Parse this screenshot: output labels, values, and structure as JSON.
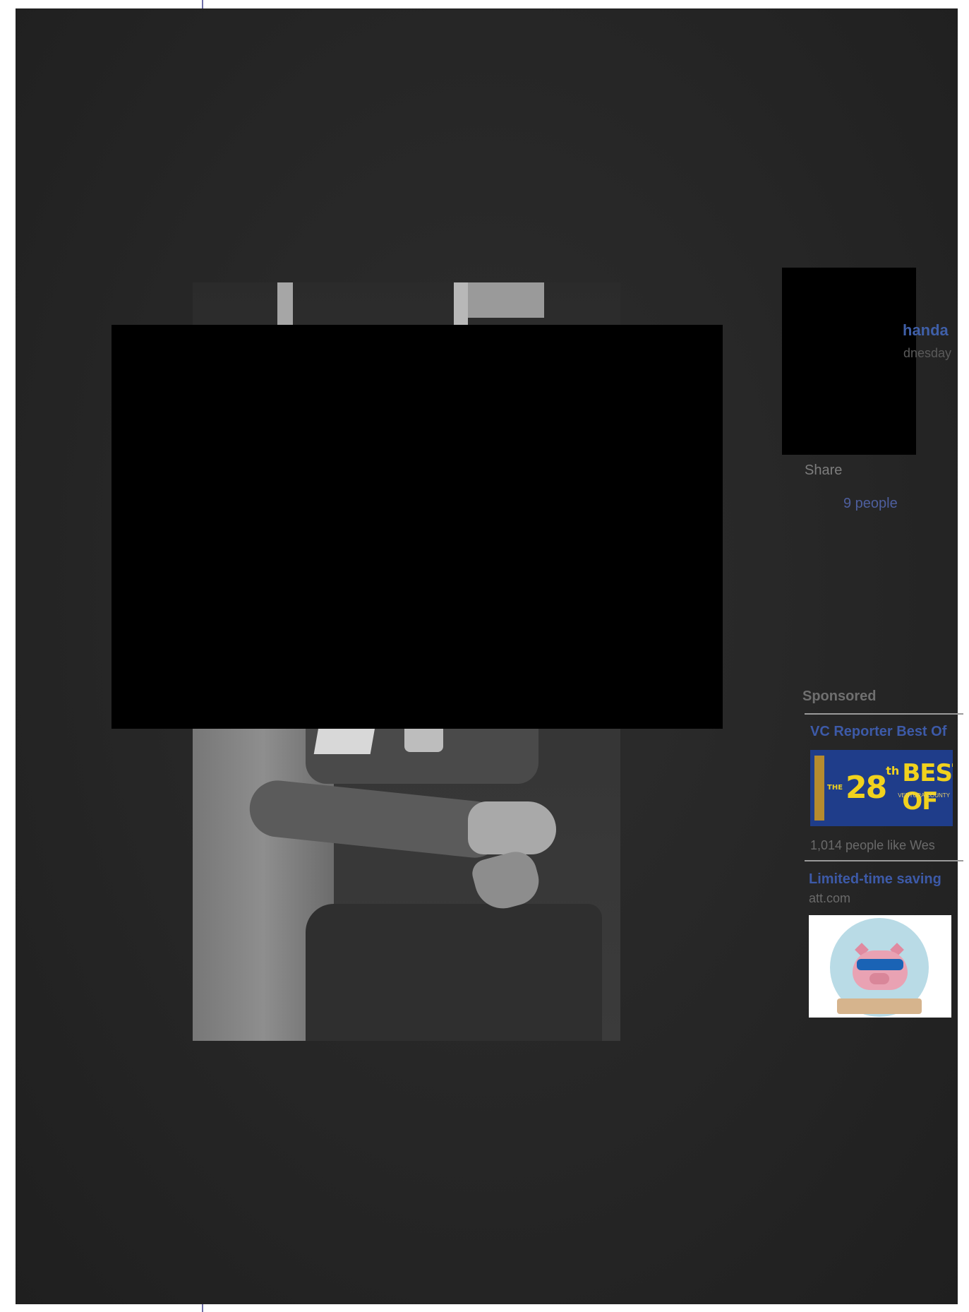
{
  "post": {
    "author_name_partial": "handa",
    "date_partial": "dnesday",
    "share_label": "Share",
    "likes_text": "9 people"
  },
  "sponsored": {
    "heading": "Sponsored",
    "ads": [
      {
        "title": "VC Reporter Best Of",
        "image_text": {
          "prefix": "THE",
          "number": "28",
          "superscript": "th",
          "main": "BEST OF",
          "sub": "VENTURA COUNTY"
        },
        "social_text": "1,014 people like Wes"
      },
      {
        "title": "Limited-time saving",
        "domain": "att.com",
        "image_icon": "piggy-bank-sunglasses-icon"
      }
    ]
  },
  "colors": {
    "overlay": "#262626",
    "link_blue": "#3d5aa8",
    "page_edge": "#6e6ea8",
    "redaction": "#000000"
  }
}
